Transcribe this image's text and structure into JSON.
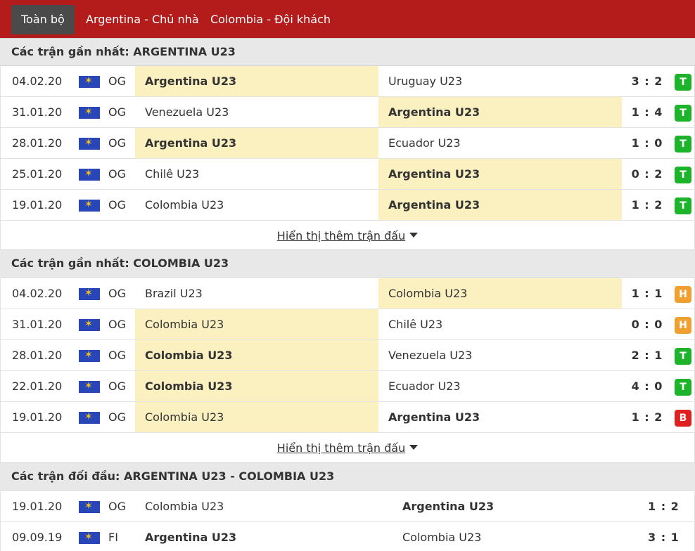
{
  "tabs": [
    "Toàn bộ",
    "Argentina - Chủ nhà",
    "Colombia - Đội khách"
  ],
  "more_label": "Hiển thị thêm trận đấu",
  "sections": [
    {
      "title": "Các trận gần nhất: ARGENTINA U23",
      "rows": [
        {
          "date": "04.02.20",
          "league": "OG",
          "home": "Argentina U23",
          "away": "Uruguay U23",
          "score": "3 : 2",
          "result": "T",
          "winner": "home",
          "hl": "home"
        },
        {
          "date": "31.01.20",
          "league": "OG",
          "home": "Venezuela U23",
          "away": "Argentina U23",
          "score": "1 : 4",
          "result": "T",
          "winner": "away",
          "hl": "away"
        },
        {
          "date": "28.01.20",
          "league": "OG",
          "home": "Argentina U23",
          "away": "Ecuador U23",
          "score": "1 : 0",
          "result": "T",
          "winner": "home",
          "hl": "home"
        },
        {
          "date": "25.01.20",
          "league": "OG",
          "home": "Chilê U23",
          "away": "Argentina U23",
          "score": "0 : 2",
          "result": "T",
          "winner": "away",
          "hl": "away"
        },
        {
          "date": "19.01.20",
          "league": "OG",
          "home": "Colombia U23",
          "away": "Argentina U23",
          "score": "1 : 2",
          "result": "T",
          "winner": "away",
          "hl": "away"
        }
      ]
    },
    {
      "title": "Các trận gần nhất: COLOMBIA U23",
      "rows": [
        {
          "date": "04.02.20",
          "league": "OG",
          "home": "Brazil U23",
          "away": "Colombia U23",
          "score": "1 : 1",
          "result": "H",
          "winner": "none",
          "hl": "away"
        },
        {
          "date": "31.01.20",
          "league": "OG",
          "home": "Colombia U23",
          "away": "Chilê U23",
          "score": "0 : 0",
          "result": "H",
          "winner": "none",
          "hl": "home"
        },
        {
          "date": "28.01.20",
          "league": "OG",
          "home": "Colombia U23",
          "away": "Venezuela U23",
          "score": "2 : 1",
          "result": "T",
          "winner": "home",
          "hl": "home"
        },
        {
          "date": "22.01.20",
          "league": "OG",
          "home": "Colombia U23",
          "away": "Ecuador U23",
          "score": "4 : 0",
          "result": "T",
          "winner": "home",
          "hl": "home"
        },
        {
          "date": "19.01.20",
          "league": "OG",
          "home": "Colombia U23",
          "away": "Argentina U23",
          "score": "1 : 2",
          "result": "B",
          "winner": "away",
          "hl": "home"
        }
      ]
    },
    {
      "title": "Các trận đối đầu: ARGENTINA U23 - COLOMBIA U23",
      "rows": [
        {
          "date": "19.01.20",
          "league": "OG",
          "home": "Colombia U23",
          "away": "Argentina U23",
          "score": "1 : 2",
          "winner": "away",
          "hl": "none"
        },
        {
          "date": "09.09.19",
          "league": "FI",
          "home": "Argentina U23",
          "away": "Colombia U23",
          "score": "3 : 1",
          "winner": "home",
          "hl": "none"
        }
      ]
    }
  ],
  "colors": {
    "topbar": "#b41c1c",
    "highlight": "#fbf0c0",
    "win": "#1db32a",
    "draw": "#f0a030",
    "loss": "#e02020"
  },
  "icons": {
    "league_flag": "olympic-flag-icon",
    "more": "caret-down-icon"
  }
}
